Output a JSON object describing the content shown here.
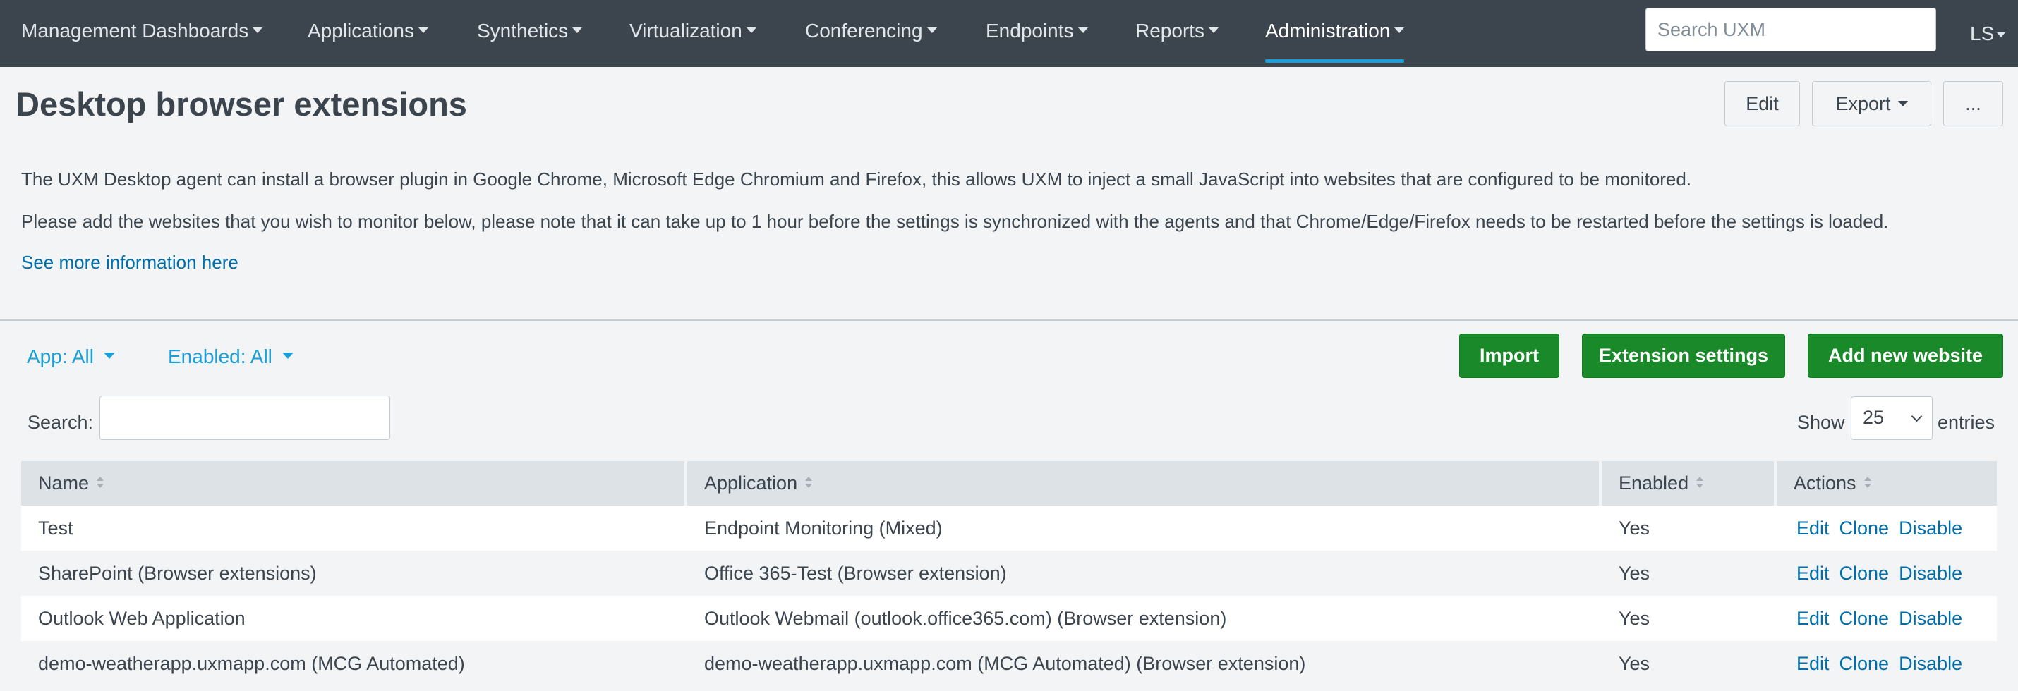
{
  "nav": {
    "items": [
      {
        "label": "Management Dashboards"
      },
      {
        "label": "Applications"
      },
      {
        "label": "Synthetics"
      },
      {
        "label": "Virtualization"
      },
      {
        "label": "Conferencing"
      },
      {
        "label": "Endpoints"
      },
      {
        "label": "Reports"
      },
      {
        "label": "Administration"
      }
    ],
    "active": "Administration",
    "search_placeholder": "Search UXM",
    "user_initials": "LS"
  },
  "header": {
    "title": "Desktop browser extensions",
    "edit_label": "Edit",
    "export_label": "Export",
    "more_label": "..."
  },
  "description": {
    "line1": "The UXM Desktop agent can install a browser plugin in Google Chrome, Microsoft Edge Chromium and Firefox, this allows UXM to inject a small JavaScript into websites that are configured to be monitored.",
    "line2": "Please add the websites that you wish to monitor below, please note that it can take up to 1 hour before the settings is synchronized with the agents and that Chrome/Edge/Firefox needs to be restarted before the settings is loaded.",
    "link": "See more information here"
  },
  "filters": {
    "app": "App: All",
    "enabled": "Enabled: All"
  },
  "actions": {
    "import": "Import",
    "extension_settings": "Extension settings",
    "add_new": "Add new website"
  },
  "search": {
    "label": "Search:",
    "value": ""
  },
  "page_size": {
    "show_label": "Show",
    "value": "25",
    "entries_label": "entries"
  },
  "table": {
    "columns": [
      "Name",
      "Application",
      "Enabled",
      "Actions"
    ],
    "action_labels": {
      "edit": "Edit",
      "clone": "Clone",
      "disable": "Disable"
    },
    "rows": [
      {
        "name": "Test",
        "application": "Endpoint Monitoring (Mixed)",
        "enabled": "Yes"
      },
      {
        "name": "SharePoint (Browser extensions)",
        "application": "Office 365-Test (Browser extension)",
        "enabled": "Yes"
      },
      {
        "name": "Outlook Web Application",
        "application": "Outlook Webmail (outlook.office365.com) (Browser extension)",
        "enabled": "Yes"
      },
      {
        "name": "demo-weatherapp.uxmapp.com (MCG Automated)",
        "application": "demo-weatherapp.uxmapp.com (MCG Automated) (Browser extension)",
        "enabled": "Yes"
      }
    ]
  },
  "colors": {
    "nav_bg": "#3c444d",
    "accent": "#1a9fd9",
    "link": "#006eaa",
    "primary_button": "#1a8929"
  }
}
